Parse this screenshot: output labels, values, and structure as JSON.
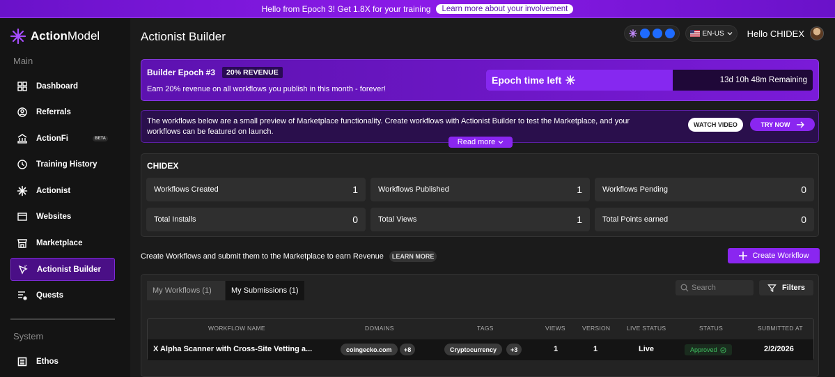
{
  "banner": {
    "text": "Hello from Epoch 3! Get 1.8X for your training",
    "button": "Learn more about your involvement"
  },
  "sidebar": {
    "logo_bold": "Action",
    "logo_rest": "Model",
    "section_main": "Main",
    "items": [
      {
        "label": "Dashboard"
      },
      {
        "label": "Referrals"
      },
      {
        "label": "ActionFi",
        "badge": "BETA"
      },
      {
        "label": "Training History"
      },
      {
        "label": "Actionist"
      },
      {
        "label": "Websites"
      },
      {
        "label": "Marketplace"
      },
      {
        "label": "Actionist Builder"
      },
      {
        "label": "Quests"
      }
    ],
    "section_system": "System",
    "system_items": [
      {
        "label": "Ethos"
      }
    ]
  },
  "header": {
    "title": "Actionist Builder",
    "lang": "EN-US",
    "greeting": "Hello CHIDEX"
  },
  "epoch": {
    "title": "Builder Epoch #3",
    "tag": "20% REVENUE",
    "subtitle": "Earn 20% revenue on all workflows you publish in this month - forever!",
    "time_label": "Epoch time left",
    "remaining": "13d 10h 48m Remaining"
  },
  "preview": {
    "text": "The workflows below are a small preview of Marketplace functionality. Create workflows with Actionist Builder to test the Marketplace, and your workflows can be featured on launch.",
    "watch": "WATCH VIDEO",
    "try": "TRY NOW",
    "read_more": "Read more"
  },
  "stats": {
    "user": "CHIDEX",
    "items": [
      {
        "label": "Workflows Created",
        "value": "1"
      },
      {
        "label": "Workflows Published",
        "value": "1"
      },
      {
        "label": "Workflows Pending",
        "value": "0"
      },
      {
        "label": "Total Installs",
        "value": "0"
      },
      {
        "label": "Total Views",
        "value": "1"
      },
      {
        "label": "Total Points earned",
        "value": "0"
      }
    ]
  },
  "create": {
    "text": "Create Workflows and submit them to the Marketplace to earn Revenue",
    "learn": "LEARN MORE",
    "button": "Create Workflow"
  },
  "submissions": {
    "tabs": [
      "My Workflows (1)",
      "My Submissions (1)"
    ],
    "search_placeholder": "Search",
    "filters": "Filters",
    "headers": [
      "WORKFLOW NAME",
      "DOMAINS",
      "TAGS",
      "VIEWS",
      "VERSION",
      "LIVE STATUS",
      "STATUS",
      "SUBMITTED AT"
    ],
    "row": {
      "name": "X Alpha Scanner with Cross-Site Vetting a...",
      "domain": "coingecko.com",
      "domain_more": "+8",
      "tag": "Cryptocurrency",
      "tag_more": "+3",
      "views": "1",
      "version": "1",
      "live": "Live",
      "status": "Approved",
      "submitted": "2/2/2026"
    }
  },
  "colors": {
    "accent": "#8a26f0",
    "sidebar_active": "#4a0f86",
    "approved": "#3fbf5f"
  }
}
